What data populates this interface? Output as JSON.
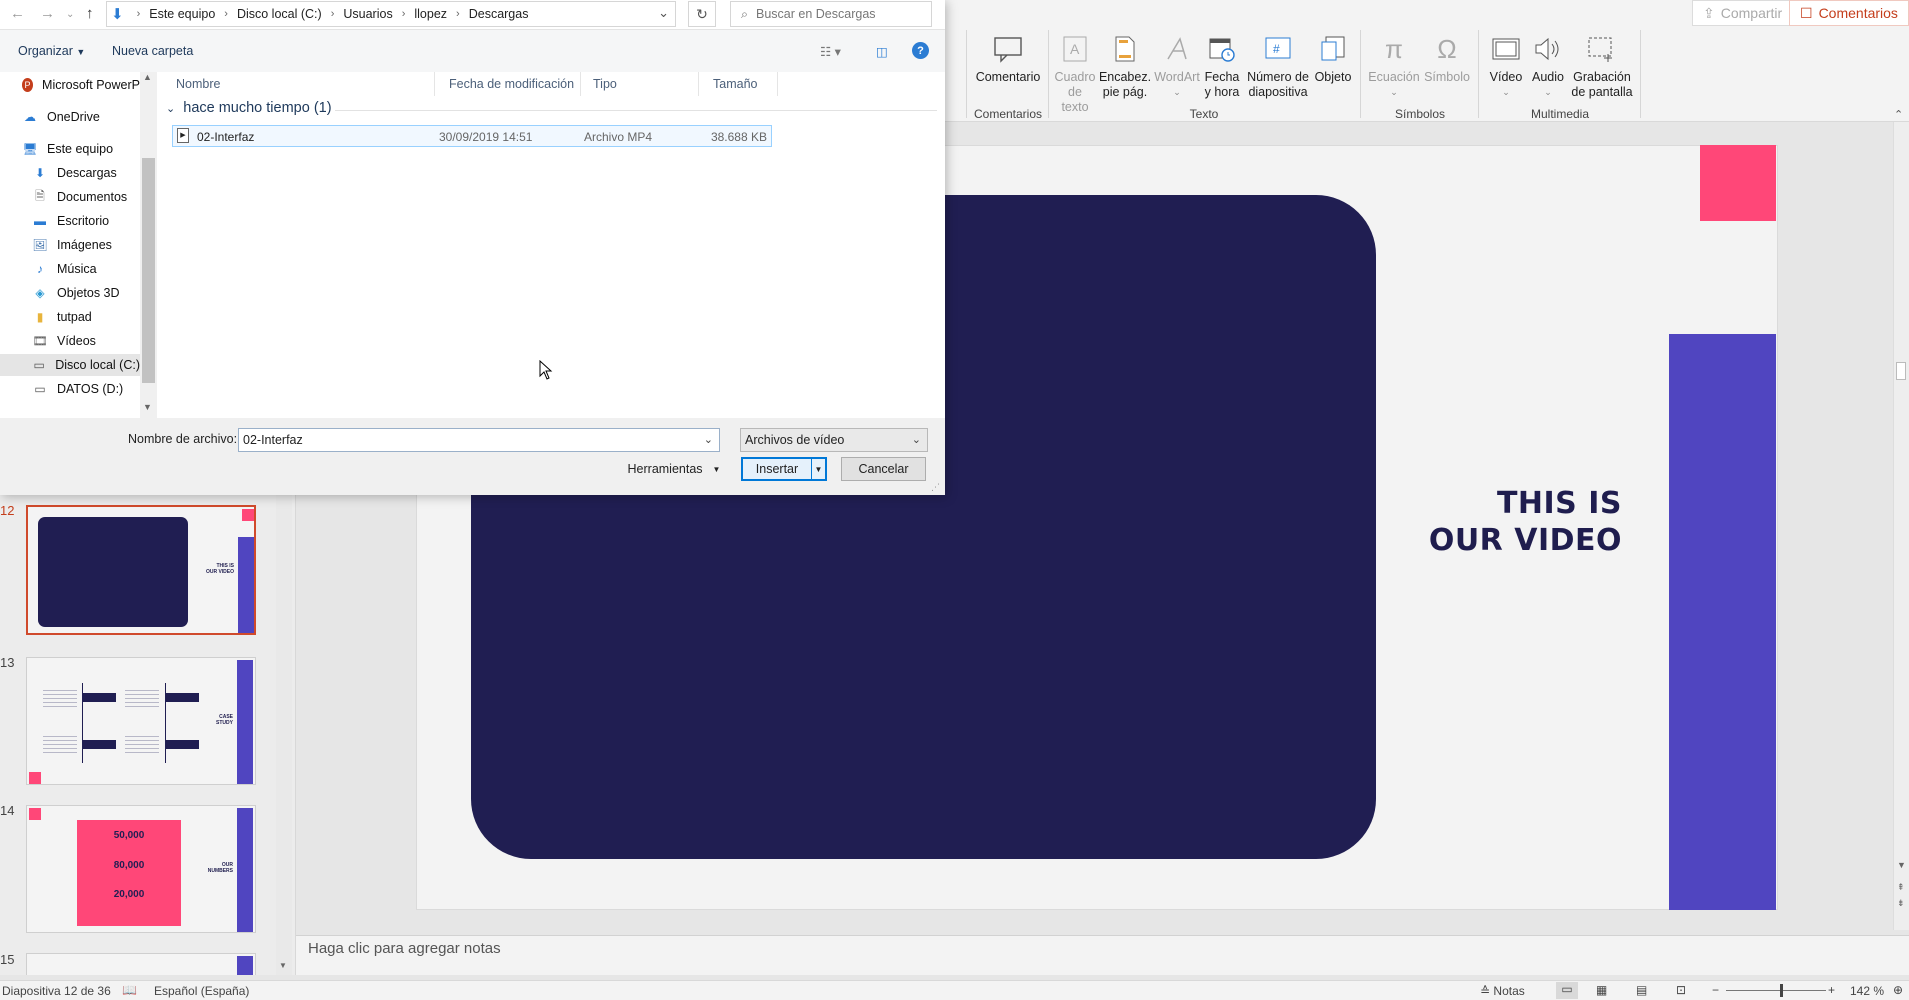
{
  "dialog": {
    "breadcrumb": [
      "Este equipo",
      "Disco local (C:)",
      "Usuarios",
      "llopez",
      "Descargas"
    ],
    "search_placeholder": "Buscar en Descargas",
    "toolbar": {
      "organize": "Organizar",
      "new_folder": "Nueva carpeta"
    },
    "nav_items": [
      {
        "label": "Microsoft PowerP",
        "icon": "powerpoint-icon"
      },
      {
        "label": "OneDrive",
        "icon": "cloud-icon"
      },
      {
        "label": "Este equipo",
        "icon": "computer-icon"
      },
      {
        "label": "Descargas",
        "icon": "download-icon"
      },
      {
        "label": "Documentos",
        "icon": "documents-icon"
      },
      {
        "label": "Escritorio",
        "icon": "desktop-icon"
      },
      {
        "label": "Imágenes",
        "icon": "images-icon"
      },
      {
        "label": "Música",
        "icon": "music-icon"
      },
      {
        "label": "Objetos 3D",
        "icon": "cube-icon"
      },
      {
        "label": "tutpad",
        "icon": "folder-icon"
      },
      {
        "label": "Vídeos",
        "icon": "video-icon"
      },
      {
        "label": "Disco local (C:)",
        "icon": "drive-icon"
      },
      {
        "label": "DATOS (D:)",
        "icon": "drive-icon"
      }
    ],
    "columns": [
      "Nombre",
      "Fecha de modificación",
      "Tipo",
      "Tamaño"
    ],
    "group_header": "hace mucho tiempo (1)",
    "files": [
      {
        "name": "02-Interfaz",
        "date": "30/09/2019 14:51",
        "type": "Archivo MP4",
        "size": "38.688 KB"
      }
    ],
    "filename_label": "Nombre de archivo:",
    "filename_value": "02-Interfaz",
    "filetype_value": "Archivos de vídeo",
    "tools_label": "Herramientas",
    "insert_label": "Insertar",
    "cancel_label": "Cancelar"
  },
  "ppt": {
    "share_label": "Compartir",
    "comments_label": "Comentarios",
    "ribbon": {
      "comment_btn": "Comentario",
      "group_comments": "Comentarios",
      "textbox_btn": [
        "Cuadro",
        "de texto"
      ],
      "header_btn": [
        "Encabez.",
        "pie pág."
      ],
      "wordart_btn": "WordArt",
      "datetime_btn": [
        "Fecha",
        "y hora"
      ],
      "slidenum_btn": [
        "Número de",
        "diapositiva"
      ],
      "object_btn": "Objeto",
      "group_text": "Texto",
      "equation_btn": "Ecuación",
      "symbol_btn": "Símbolo",
      "group_symbols": "Símbolos",
      "video_btn": "Vídeo",
      "audio_btn": "Audio",
      "record_btn": [
        "Grabación",
        "de pantalla"
      ],
      "group_media": "Multimedia"
    },
    "slide_numbers": [
      "12",
      "13",
      "14",
      "15"
    ],
    "thumb13": {
      "title": [
        "CASE",
        "STUDY"
      ]
    },
    "thumb14": {
      "numbers": [
        "50,000",
        "80,000",
        "20,000"
      ],
      "title": [
        "OUR",
        "NUMBERS"
      ]
    },
    "thumb12": {
      "title": [
        "THIS IS",
        "OUR VIDEO"
      ]
    },
    "slide_title": [
      "THIS IS",
      "OUR VIDEO"
    ],
    "notes_placeholder": "Haga clic para agregar notas",
    "status": {
      "slide_info": "Diapositiva 12 de 36",
      "language": "Español (España)",
      "notes": "Notas",
      "zoom": "142 %"
    },
    "colors": {
      "navy": "#201e52",
      "pink": "#ff4778",
      "purple": "#5045c0",
      "accent_red": "#c43e1c"
    }
  }
}
